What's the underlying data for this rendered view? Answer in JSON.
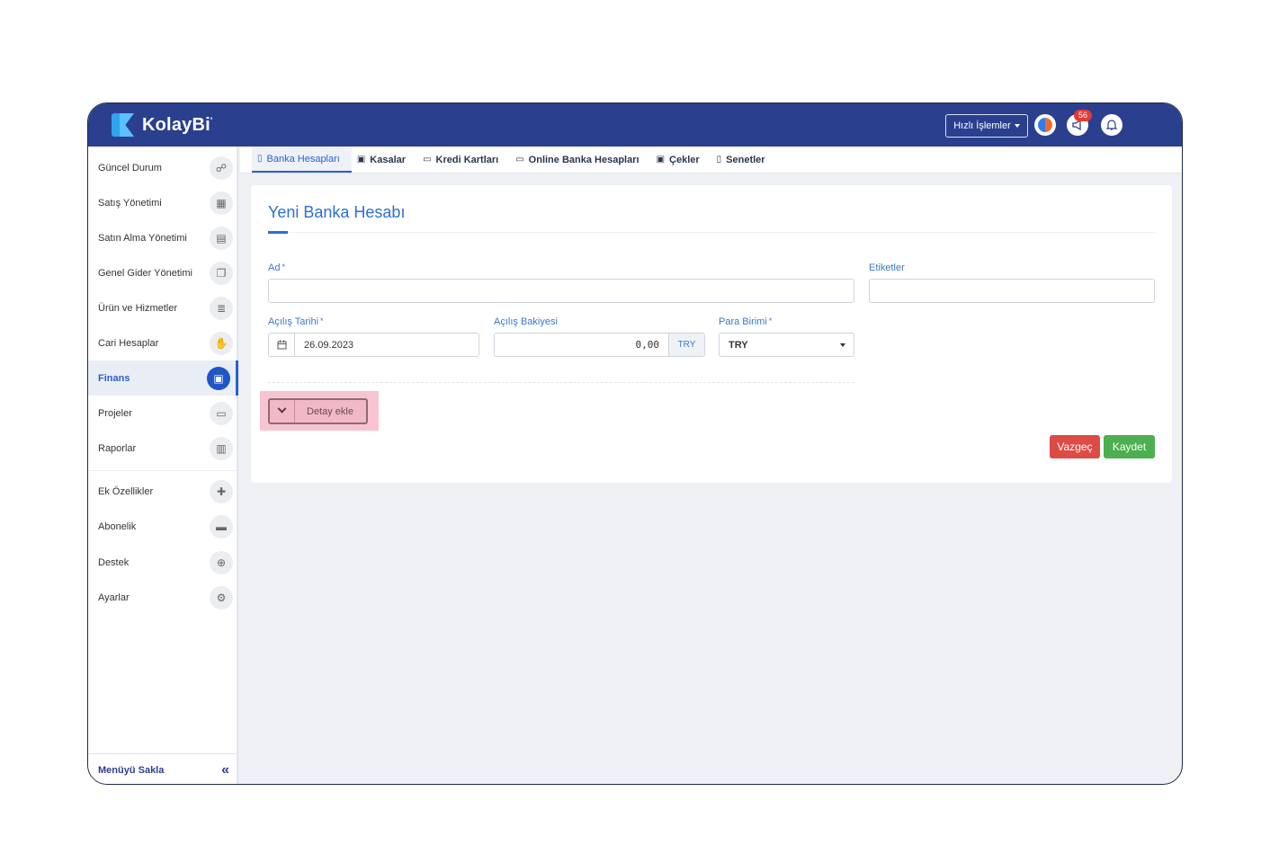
{
  "brand": {
    "name": "KolayBi",
    "mark": "'"
  },
  "topbar": {
    "quick_actions_label": "Hızlı İşlemler",
    "notifications_badge": "56"
  },
  "sidebar": {
    "items": [
      {
        "label": "Güncel Durum",
        "icon": "☍"
      },
      {
        "label": "Satış Yönetimi",
        "icon": "▦"
      },
      {
        "label": "Satın Alma Yönetimi",
        "icon": "▤"
      },
      {
        "label": "Genel Gider Yönetimi",
        "icon": "❐"
      },
      {
        "label": "Ürün ve Hizmetler",
        "icon": "≣"
      },
      {
        "label": "Cari Hesaplar",
        "icon": "✋"
      },
      {
        "label": "Finans",
        "icon": "▣"
      },
      {
        "label": "Projeler",
        "icon": "▭"
      },
      {
        "label": "Raporlar",
        "icon": "▥"
      },
      {
        "label": "Ek Özellikler",
        "icon": "✚"
      },
      {
        "label": "Abonelik",
        "icon": "▬"
      },
      {
        "label": "Destek",
        "icon": "⊕"
      },
      {
        "label": "Ayarlar",
        "icon": "⚙"
      }
    ],
    "hide_menu_label": "Menüyü Sakla",
    "hide_menu_icon": "«"
  },
  "tabs": [
    {
      "label": "Banka Hesapları",
      "icon": "▯"
    },
    {
      "label": "Kasalar",
      "icon": "▣"
    },
    {
      "label": "Kredi Kartları",
      "icon": "▭"
    },
    {
      "label": "Online Banka Hesapları",
      "icon": "▭"
    },
    {
      "label": "Çekler",
      "icon": "▣"
    },
    {
      "label": "Senetler",
      "icon": "▯"
    }
  ],
  "form": {
    "title": "Yeni Banka Hesabı",
    "name_label": "Ad",
    "tags_label": "Etiketler",
    "opening_date_label": "Açılış Tarihi",
    "opening_date_value": "26.09.2023",
    "opening_balance_label": "Açılış Bakiyesi",
    "opening_balance_value": "0,00",
    "balance_currency": "TRY",
    "currency_label": "Para Birimi",
    "currency_value": "TRY",
    "required_mark": "*",
    "add_detail_label": "Detay ekle",
    "cancel_label": "Vazgeç",
    "save_label": "Kaydet"
  },
  "colors": {
    "topbar": "#2b3f8f",
    "accent": "#2b6fd6",
    "cancel": "#dd4b45",
    "save": "#4caf50",
    "highlight": "#f8c4d1"
  }
}
